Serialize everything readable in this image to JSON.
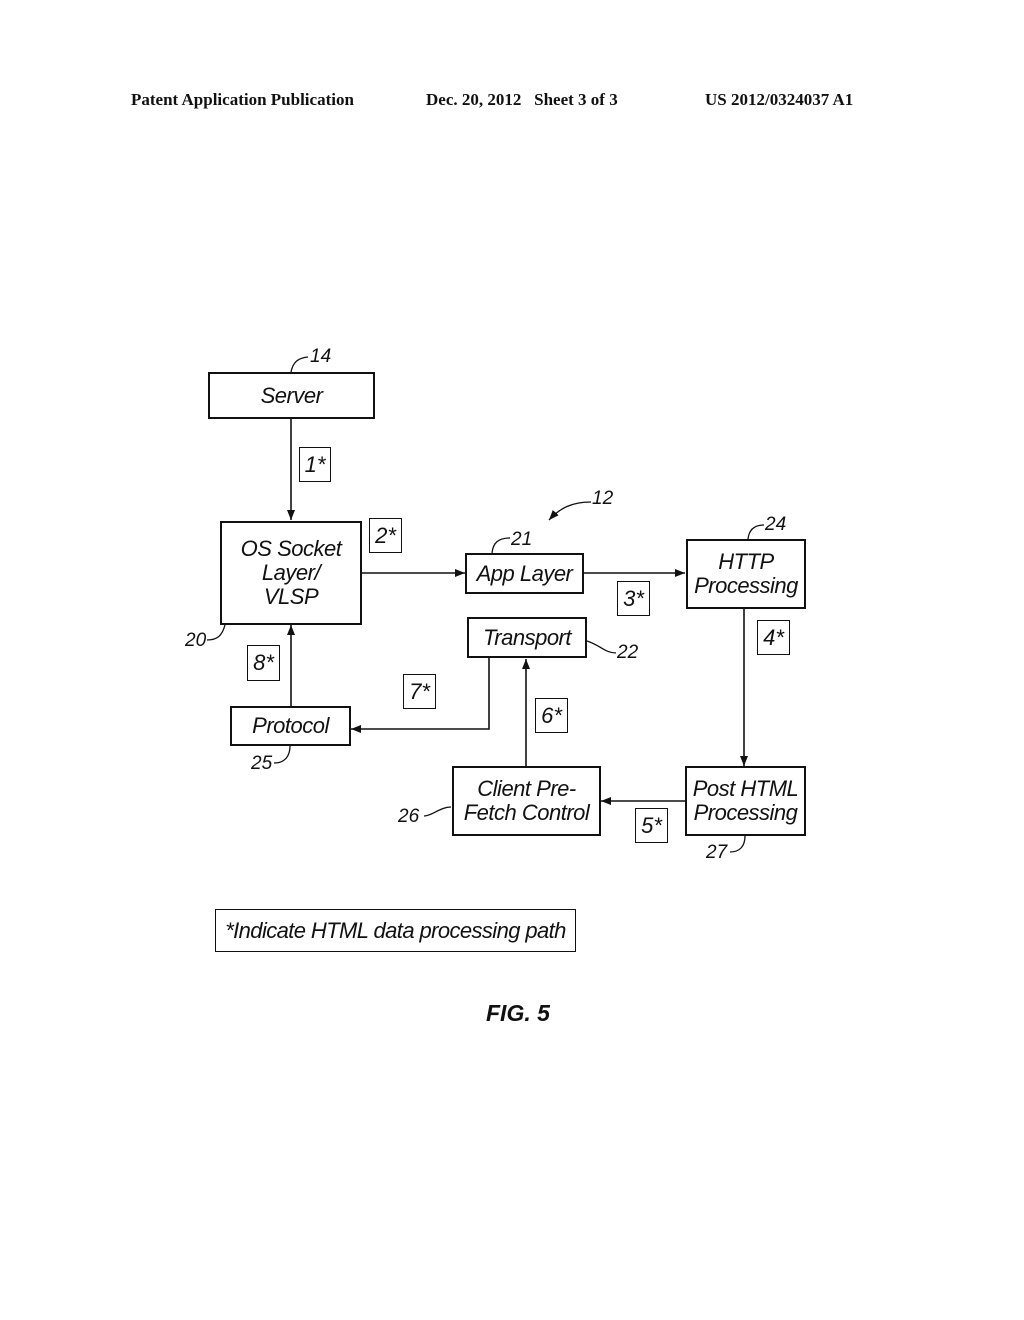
{
  "header": {
    "publication": "Patent Application Publication",
    "date_sheet": "Dec. 20, 2012   Sheet 3 of 3",
    "patent_number": "US 2012/0324037 A1"
  },
  "diagram": {
    "system_ref": "12",
    "blocks": {
      "server": {
        "label": "Server",
        "ref": "14"
      },
      "os_socket": {
        "label_lines": [
          "OS Socket",
          "Layer/",
          "VLSP"
        ],
        "ref": "20"
      },
      "app_layer": {
        "label": "App Layer",
        "ref": "21"
      },
      "transport": {
        "label": "Transport",
        "ref": "22"
      },
      "http_processing": {
        "label_lines": [
          "HTTP",
          "Processing"
        ],
        "ref": "24"
      },
      "protocol": {
        "label": "Protocol",
        "ref": "25"
      },
      "client_prefetch": {
        "label_lines": [
          "Client Pre-",
          "Fetch Control"
        ],
        "ref": "26"
      },
      "post_html": {
        "label_lines": [
          "Post HTML",
          "Processing"
        ],
        "ref": "27"
      }
    },
    "path_steps": [
      "1*",
      "2*",
      "3*",
      "4*",
      "5*",
      "6*",
      "7*",
      "8*"
    ],
    "edges": [
      {
        "from": "server",
        "to": "os_socket",
        "step": "1*"
      },
      {
        "from": "os_socket",
        "to": "app_layer",
        "step": "2*"
      },
      {
        "from": "app_layer",
        "to": "http_processing",
        "step": "3*"
      },
      {
        "from": "http_processing",
        "to": "post_html",
        "step": "4*"
      },
      {
        "from": "post_html",
        "to": "client_prefetch",
        "step": "5*"
      },
      {
        "from": "client_prefetch",
        "to": "transport",
        "step": "6*"
      },
      {
        "from": "transport",
        "to": "protocol",
        "step": "7*"
      },
      {
        "from": "protocol",
        "to": "os_socket",
        "step": "8*"
      }
    ],
    "legend": "*Indicate HTML data processing path",
    "figure_label": "FIG. 5"
  }
}
